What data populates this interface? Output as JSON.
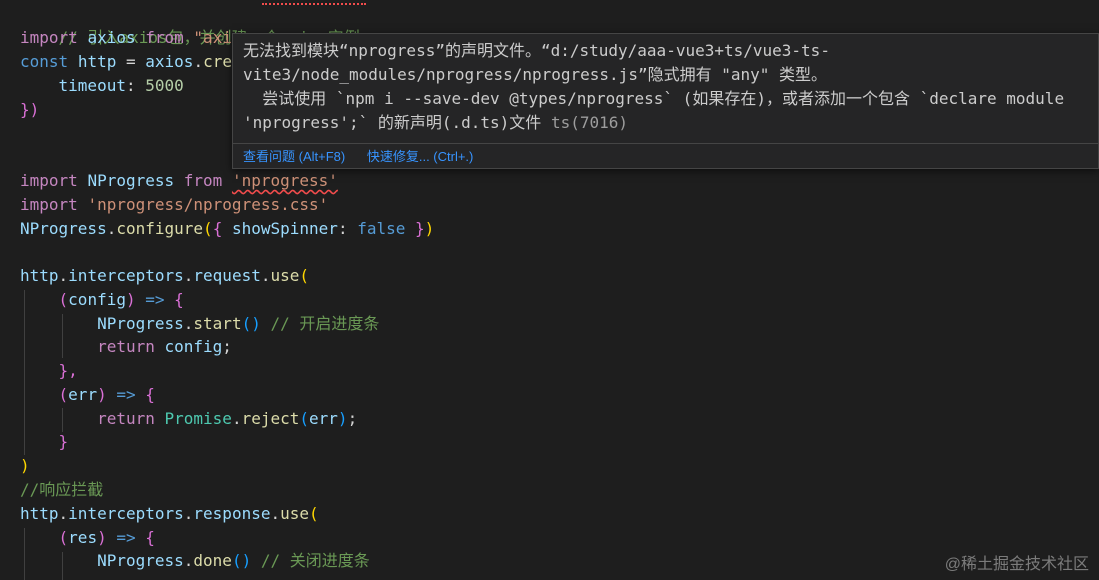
{
  "code": {
    "line1_comment": "// 引入axios包，并创建一个axios实例",
    "line2": {
      "kw_import": "import",
      "name": "axios",
      "kw_from": "from",
      "string_fragment": "\"axi",
      "string_tail": "s\""
    },
    "line3": {
      "kw_const": "const",
      "name": "http",
      "eq": "=",
      "obj": "axios",
      "dot": ".",
      "method_fragment": "cre"
    },
    "line4": {
      "prop": "timeout",
      "colon": ":",
      "value": "5000"
    },
    "line5": {
      "close": "})"
    },
    "line8": {
      "kw_import": "import",
      "name": "NProgress",
      "kw_from": "from",
      "module": "'nprogress'"
    },
    "line9": {
      "kw_import": "import",
      "module": "'nprogress/nprogress.css'"
    },
    "line10": {
      "obj": "NProgress",
      "method": "configure",
      "prop": "showSpinner",
      "value": "false"
    },
    "line12": {
      "obj": "http",
      "prop1": "interceptors",
      "prop2": "request",
      "method": "use"
    },
    "line13": {
      "param": "config",
      "arrow": "=>"
    },
    "line14": {
      "obj": "NProgress",
      "method": "start",
      "comment": "// 开启进度条"
    },
    "line15": {
      "kw_return": "return",
      "value": "config"
    },
    "line16": {
      "close": "},"
    },
    "line17": {
      "param": "err",
      "arrow": "=>"
    },
    "line18": {
      "kw_return": "return",
      "cls": "Promise",
      "method": "reject",
      "arg": "err"
    },
    "line19": {
      "close": "}"
    },
    "line20": {
      "close": ")"
    },
    "line21_comment": "//响应拦截",
    "line22": {
      "obj": "http",
      "prop1": "interceptors",
      "prop2": "response",
      "method": "use"
    },
    "line23": {
      "param": "res",
      "arrow": "=>"
    },
    "line24": {
      "obj": "NProgress",
      "method": "done",
      "comment": "// 关闭进度条"
    }
  },
  "hover": {
    "line1": "无法找到模块“nprogress”的声明文件。“d:/study/aaa-vue3+ts/vue3-ts-",
    "line2": "vite3/node_modules/nprogress/nprogress.js”隐式拥有 \"any\" 类型。",
    "line3": "  尝试使用 `npm i --save-dev @types/nprogress` (如果存在)，或者添加一个包含 `declare module",
    "line4_text": "'nprogress';` 的新声明(.d.ts)文件 ",
    "line4_code": "ts(7016)",
    "action_view_problem": "查看问题 (Alt+F8)",
    "action_quick_fix": "快速修复... (Ctrl+.)"
  },
  "watermark": "@稀土掘金技术社区",
  "colors": {
    "background": "#1e1e1e",
    "keyword": "#569cd6",
    "control_keyword": "#c586c0",
    "string": "#ce9178",
    "comment": "#6a9955",
    "function": "#dcdcaa",
    "variable": "#9cdcfe",
    "link": "#3794ff",
    "error_squiggle": "#f14c4c"
  }
}
